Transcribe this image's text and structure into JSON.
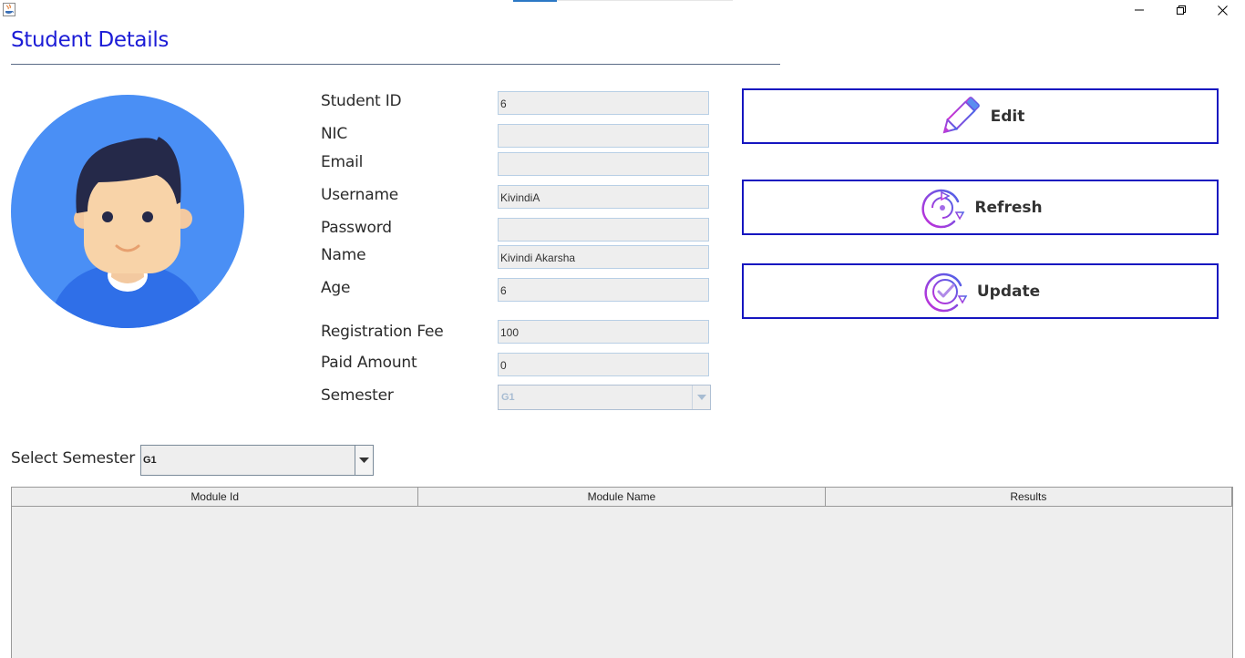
{
  "window": {
    "app_icon": "java-icon",
    "controls": [
      "minimize-icon",
      "restore-icon",
      "close-icon"
    ]
  },
  "page": {
    "title": "Student Details"
  },
  "avatar": {
    "icon": "student-avatar-illustration"
  },
  "form": {
    "student_id": {
      "label": "Student ID",
      "value": "6"
    },
    "nic": {
      "label": "NIC",
      "value": ""
    },
    "email": {
      "label": "Email",
      "value": ""
    },
    "username": {
      "label": "Username",
      "value": "KivindiA"
    },
    "password": {
      "label": "Password",
      "value": ""
    },
    "name": {
      "label": "Name",
      "value": "Kivindi Akarsha"
    },
    "age": {
      "label": "Age",
      "value": "6"
    },
    "registration_fee": {
      "label": "Registration Fee",
      "value": "100"
    },
    "paid_amount": {
      "label": "Paid Amount",
      "value": "0"
    },
    "semester": {
      "label": "Semester",
      "value": "G1"
    }
  },
  "actions": {
    "edit": {
      "label": "Edit",
      "icon": "pencil-icon"
    },
    "refresh": {
      "label": "Refresh",
      "icon": "refresh-icon"
    },
    "update": {
      "label": "Update",
      "icon": "update-check-icon"
    }
  },
  "semester_select": {
    "label": "Select Semester",
    "value": "G1"
  },
  "table": {
    "columns": [
      "Module Id",
      "Module Name",
      "Results"
    ],
    "rows": []
  },
  "colors": {
    "title": "#1c1cd6",
    "button_border": "#1616c0",
    "avatar_bg": "#4a8ff5"
  }
}
